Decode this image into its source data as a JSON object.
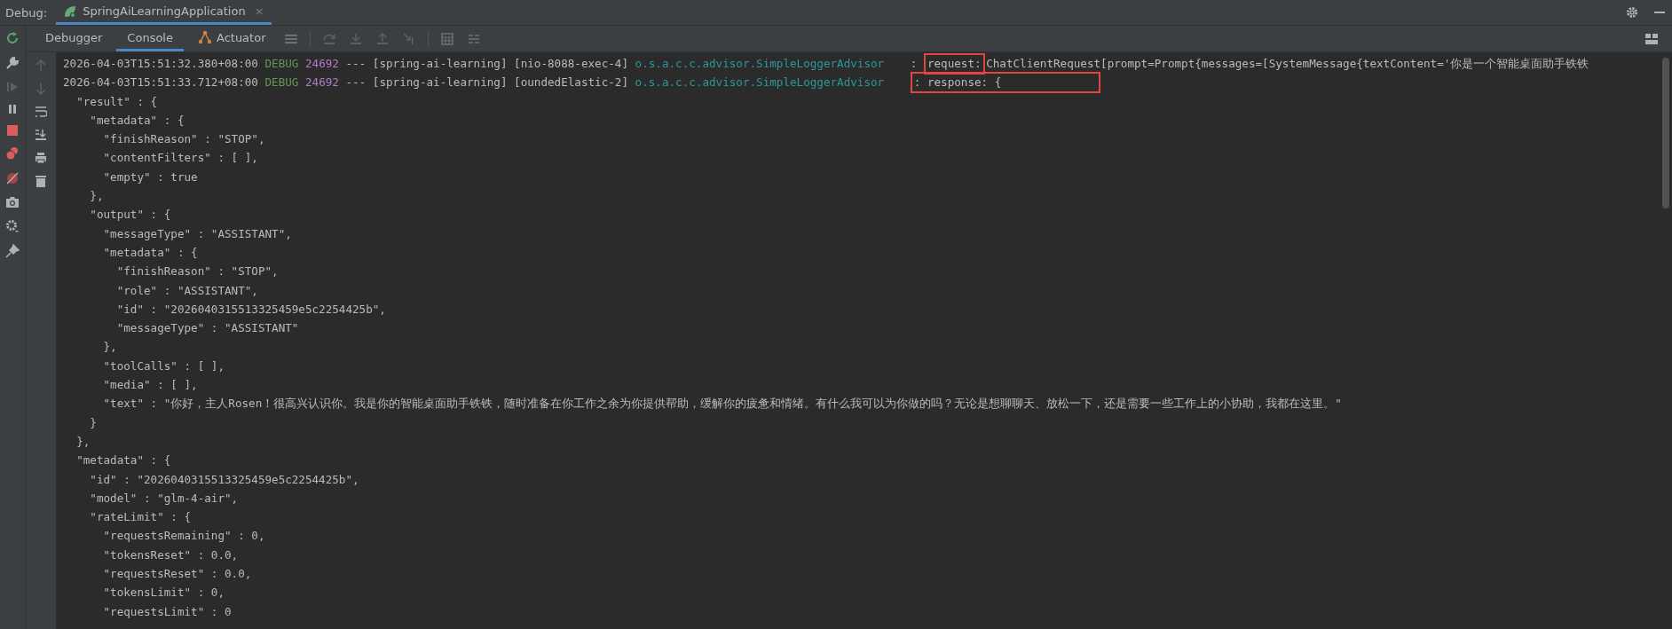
{
  "panel": {
    "label": "Debug:"
  },
  "run_tabs": [
    {
      "label": "SpringAiLearningApplication",
      "selected": true,
      "close": "×"
    }
  ],
  "tabs": [
    {
      "label": "Debugger",
      "selected": false,
      "kind": "text"
    },
    {
      "label": "Console",
      "selected": true,
      "kind": "text"
    },
    {
      "label": "Actuator",
      "selected": false,
      "kind": "actuator"
    }
  ],
  "log_lines": [
    {
      "timestamp": "2026-04-03T15:51:32.380+08:00",
      "level": "DEBUG",
      "pid": "24692",
      "separator": "---",
      "app": "[spring-ai-learning]",
      "thread": "[nio-8088-exec-4]",
      "logger": "o.s.a.c.c.advisor.SimpleLoggerAdvisor",
      "prefix": ":",
      "highlight": "request:",
      "message": "ChatClientRequest[prompt=Prompt{messages=[SystemMessage{textContent='你是一个智能桌面助手铁铁"
    },
    {
      "timestamp": "2026-04-03T15:51:33.712+08:00",
      "level": "DEBUG",
      "pid": "24692",
      "separator": "---",
      "app": "[spring-ai-learning]",
      "thread": "[oundedElastic-2]",
      "logger": "o.s.a.c.c.advisor.SimpleLoggerAdvisor",
      "highlight": ": response: {"
    }
  ],
  "json_lines": [
    "  \"result\" : {",
    "    \"metadata\" : {",
    "      \"finishReason\" : \"STOP\",",
    "      \"contentFilters\" : [ ],",
    "      \"empty\" : true",
    "    },",
    "    \"output\" : {",
    "      \"messageType\" : \"ASSISTANT\",",
    "      \"metadata\" : {",
    "        \"finishReason\" : \"STOP\",",
    "        \"role\" : \"ASSISTANT\",",
    "        \"id\" : \"2026040315513325459e5c2254425b\",",
    "        \"messageType\" : \"ASSISTANT\"",
    "      },",
    "      \"toolCalls\" : [ ],",
    "      \"media\" : [ ],",
    "      \"text\" : \"你好，主人Rosen！很高兴认识你。我是你的智能桌面助手铁铁，随时准备在你工作之余为你提供帮助，缓解你的疲惫和情绪。有什么我可以为你做的吗？无论是想聊聊天、放松一下，还是需要一些工作上的小协助，我都在这里。\"",
    "    }",
    "  },",
    "  \"metadata\" : {",
    "    \"id\" : \"2026040315513325459e5c2254425b\",",
    "    \"model\" : \"glm-4-air\",",
    "    \"rateLimit\" : {",
    "      \"requestsRemaining\" : 0,",
    "      \"tokensReset\" : 0.0,",
    "      \"requestsReset\" : 0.0,",
    "      \"tokensLimit\" : 0,",
    "      \"requestsLimit\" : 0"
  ]
}
